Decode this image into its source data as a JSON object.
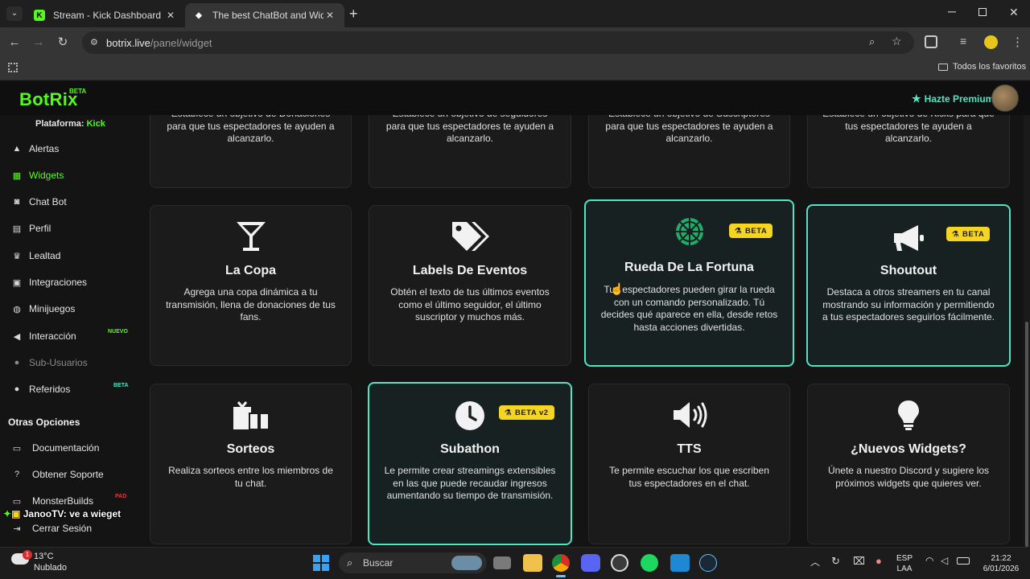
{
  "browser": {
    "tabs": [
      {
        "title": "Stream - Kick Dashboard",
        "favicon": "K"
      },
      {
        "title": "The best ChatBot and Widgets",
        "favicon": "◆"
      }
    ],
    "url_host": "botrix.live",
    "url_path": "/panel/widget",
    "bookmarks_label": "Todos los favoritos"
  },
  "app": {
    "logo": "BotRix",
    "logo_badge": "BETA",
    "premium_label": "Hazte Premium",
    "platform_label": "Plataforma:",
    "platform_value": "Kick"
  },
  "sidebar": {
    "items": [
      {
        "label": "Alertas",
        "icon": "warning-icon"
      },
      {
        "label": "Widgets",
        "icon": "grid-icon"
      },
      {
        "label": "Chat Bot",
        "icon": "robot-icon"
      },
      {
        "label": "Perfil",
        "icon": "id-card-icon"
      },
      {
        "label": "Lealtad",
        "icon": "trophy-icon"
      },
      {
        "label": "Integraciones",
        "icon": "window-icon"
      },
      {
        "label": "Minijuegos",
        "icon": "gamepad-icon"
      },
      {
        "label": "Interacción",
        "icon": "megaphone-icon",
        "badge": "NUEVO"
      },
      {
        "label": "Sub-Usuarios",
        "icon": "users-icon"
      },
      {
        "label": "Referidos",
        "icon": "users-icon",
        "badge": "BETA"
      }
    ],
    "other_heading": "Otras Opciones",
    "other_items": [
      {
        "label": "Documentación",
        "icon": "book-icon"
      },
      {
        "label": "Obtener Soporte",
        "icon": "question-icon"
      },
      {
        "label": "MonsterBuilds",
        "icon": "laptop-icon",
        "badge": "PAD"
      },
      {
        "label": "Cerrar Sesión",
        "icon": "logout-icon"
      }
    ]
  },
  "top_cards": [
    {
      "desc": "Establece un objetivo de Donaciones para que tus espectadores te ayuden a alcanzarlo."
    },
    {
      "desc": "Establece un objetivo de seguidores para que tus espectadores te ayuden a alcanzarlo."
    },
    {
      "desc": "Establece un objetivo de Suscriptores para que tus espectadores te ayuden a alcanzarlo."
    },
    {
      "desc": "Establece un objetivo de Kicks para que tus espectadores te ayuden a alcanzarlo."
    }
  ],
  "cards": [
    {
      "title": "La Copa",
      "desc": "Agrega una copa dinámica a tu transmisión, llena de donaciones de tus fans.",
      "icon": "cocktail-icon"
    },
    {
      "title": "Labels De Eventos",
      "desc": "Obtén el texto de tus últimos eventos como el último seguidor, el último suscriptor y muchos más.",
      "icon": "tags-icon"
    },
    {
      "title": "Rueda De La Fortuna",
      "desc": "Tus espectadores pueden girar la rueda con un comando personalizado. Tú decides qué aparece en ella, desde retos hasta acciones divertidas.",
      "icon": "wheel-icon",
      "badge": "BETA"
    },
    {
      "title": "Shoutout",
      "desc": "Destaca a otros streamers en tu canal mostrando su información y permitiendo a tus espectadores seguirlos fácilmente.",
      "icon": "bullhorn-icon",
      "badge": "BETA"
    },
    {
      "title": "Sorteos",
      "desc": "Realiza sorteos entre los miembros de tu chat.",
      "icon": "gifts-icon"
    },
    {
      "title": "Subathon",
      "desc": "Le permite crear streamings extensibles en las que puede recaudar ingresos aumentando su tiempo de transmisión.",
      "icon": "clock-icon",
      "badge": "BETA v2"
    },
    {
      "title": "TTS",
      "desc": "Te permite escuchar los que escriben tus espectadores en el chat.",
      "icon": "volume-icon"
    },
    {
      "title": "¿Nuevos Widgets?",
      "desc": "Únete a nuestro Discord y sugiere los próximos widgets que quieres ver.",
      "icon": "lightbulb-icon"
    }
  ],
  "overlay": {
    "user": "JanooTV",
    "message": ": ve a wieget"
  },
  "taskbar": {
    "weather_temp": "13°C",
    "weather_desc": "Nublado",
    "weather_badge": "1",
    "search_placeholder": "Buscar",
    "lang_top": "ESP",
    "lang_bottom": "LAA",
    "time": "21:22",
    "date": "6/01/2026"
  },
  "colors": {
    "accent_green": "#53fc18",
    "accent_teal": "#4ee6c3",
    "beta_yellow": "#f5d524"
  }
}
